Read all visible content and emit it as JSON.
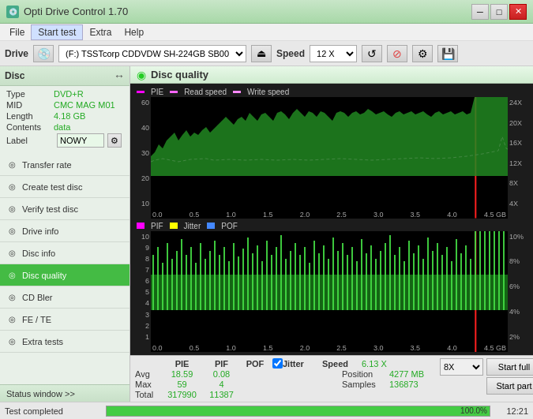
{
  "titleBar": {
    "icon": "💿",
    "title": "Opti Drive Control 1.70",
    "minBtn": "─",
    "maxBtn": "□",
    "closeBtn": "✕"
  },
  "menuBar": {
    "items": [
      "File",
      "Start test",
      "Extra",
      "Help"
    ],
    "active": "Start test"
  },
  "driveBar": {
    "driveLabel": "Drive",
    "driveValue": "(F:) TSSTcorp CDDVDW SH-224GB SB00",
    "speedLabel": "Speed",
    "speedValue": "12 X"
  },
  "sidebar": {
    "discTitle": "Disc",
    "discInfo": {
      "type": {
        "label": "Type",
        "value": "DVD+R"
      },
      "mid": {
        "label": "MID",
        "value": "CMC MAG M01"
      },
      "length": {
        "label": "Length",
        "value": "4.18 GB"
      },
      "contents": {
        "label": "Contents",
        "value": "data"
      },
      "label": {
        "label": "Label",
        "value": "NOWY"
      }
    },
    "navItems": [
      {
        "id": "transfer-rate",
        "label": "Transfer rate",
        "icon": "◎"
      },
      {
        "id": "create-test-disc",
        "label": "Create test disc",
        "icon": "◎"
      },
      {
        "id": "verify-test-disc",
        "label": "Verify test disc",
        "icon": "◎"
      },
      {
        "id": "drive-info",
        "label": "Drive info",
        "icon": "◎"
      },
      {
        "id": "disc-info",
        "label": "Disc info",
        "icon": "◎"
      },
      {
        "id": "disc-quality",
        "label": "Disc quality",
        "icon": "◎",
        "active": true
      },
      {
        "id": "cd-bler",
        "label": "CD Bler",
        "icon": "◎"
      },
      {
        "id": "fe-te",
        "label": "FE / TE",
        "icon": "◎"
      },
      {
        "id": "extra-tests",
        "label": "Extra tests",
        "icon": "◎"
      }
    ],
    "statusWindow": "Status window >>"
  },
  "content": {
    "title": "Disc quality",
    "icon": "◉",
    "upperChart": {
      "legend": [
        {
          "label": "PIE",
          "color": "#ff00ff"
        },
        {
          "label": "Read speed",
          "color": "#ff00ff"
        },
        {
          "label": "Write speed",
          "color": "#ff00ff"
        }
      ],
      "yMax": 60,
      "yLabels": [
        "60",
        "40",
        "30",
        "20",
        "10"
      ],
      "xLabels": [
        "0.0",
        "0.5",
        "1.0",
        "1.5",
        "2.0",
        "2.5",
        "3.0",
        "3.5",
        "4.0",
        "4.5 GB"
      ],
      "yRightLabels": [
        "24X",
        "20X",
        "16X",
        "12X",
        "8X",
        "4X"
      ]
    },
    "lowerChart": {
      "legend": [
        {
          "label": "PIF",
          "color": "#ff00ff"
        },
        {
          "label": "Jitter",
          "color": "#ffff00"
        },
        {
          "label": "POF",
          "color": "#4488ff"
        }
      ],
      "yMax": 10,
      "yLabels": [
        "10",
        "9",
        "8",
        "7",
        "6",
        "5",
        "4",
        "3",
        "2",
        "1"
      ],
      "xLabels": [
        "0.0",
        "0.5",
        "1.0",
        "1.5",
        "2.0",
        "2.5",
        "3.0",
        "3.5",
        "4.0",
        "4.5 GB"
      ],
      "yRightLabels": [
        "10%",
        "8%",
        "6%",
        "4%",
        "2%"
      ]
    }
  },
  "stats": {
    "headers": [
      "PIE",
      "PIF",
      "POF",
      "Jitter"
    ],
    "jitterChecked": true,
    "rows": [
      {
        "label": "Avg",
        "pie": "18.59",
        "pif": "0.08",
        "pof": "",
        "jitter": ""
      },
      {
        "label": "Max",
        "pie": "59",
        "pif": "4",
        "pof": "",
        "jitter": ""
      },
      {
        "label": "Total",
        "pie": "317990",
        "pif": "11387",
        "pof": "",
        "jitter": ""
      }
    ],
    "right": {
      "speedLabel": "Speed",
      "speedValue": "6.13 X",
      "positionLabel": "Position",
      "positionValue": "4277 MB",
      "samplesLabel": "Samples",
      "samplesValue": "136873"
    },
    "speedSelect": "8X",
    "startFull": "Start full",
    "startPart": "Start part"
  },
  "statusBar": {
    "text": "Test completed",
    "progress": 100.0,
    "progressText": "100.0%",
    "time": "12:21"
  }
}
